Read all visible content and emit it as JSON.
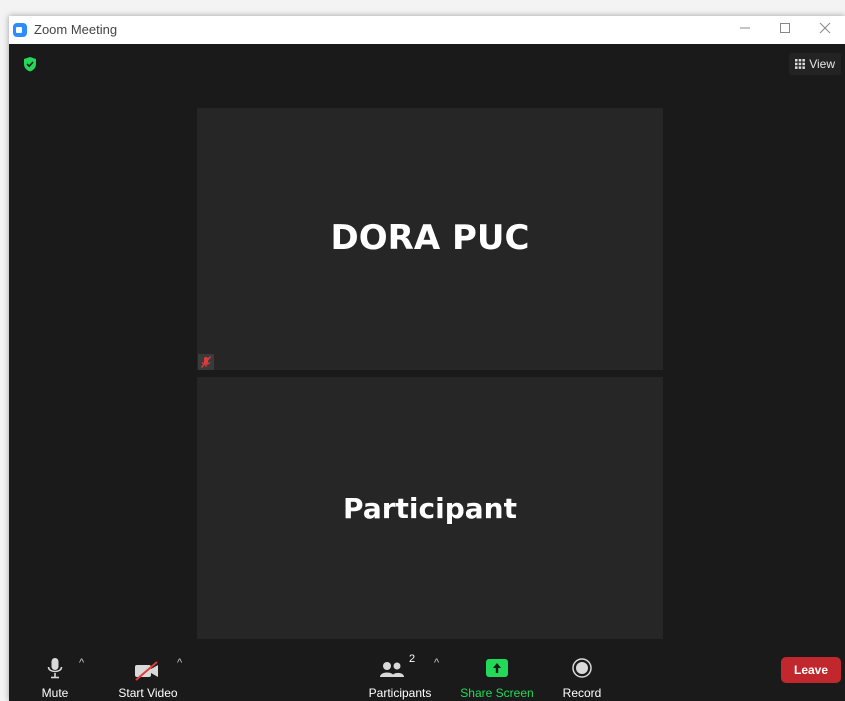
{
  "window": {
    "title": "Zoom Meeting"
  },
  "header": {
    "view_label": "View"
  },
  "tiles": [
    {
      "name": "DORA PUC",
      "muted": true
    },
    {
      "name": "Participant",
      "muted": false
    }
  ],
  "toolbar": {
    "mute_label": "Mute",
    "start_video_label": "Start Video",
    "participants_label": "Participants",
    "participants_count": "2",
    "share_screen_label": "Share Screen",
    "record_label": "Record",
    "leave_label": "Leave"
  },
  "colors": {
    "accent_green": "#23d959",
    "leave_red": "#c0282d",
    "zoom_blue": "#2d8cff",
    "muted_red": "#e03b3b"
  },
  "icons": [
    "zoom-app-icon",
    "minimize-icon",
    "maximize-icon",
    "close-icon",
    "shield-icon",
    "grid-icon",
    "muted-mic-icon",
    "microphone-icon",
    "video-off-icon",
    "participants-icon",
    "share-screen-icon",
    "record-icon",
    "chevron-up-icon"
  ]
}
